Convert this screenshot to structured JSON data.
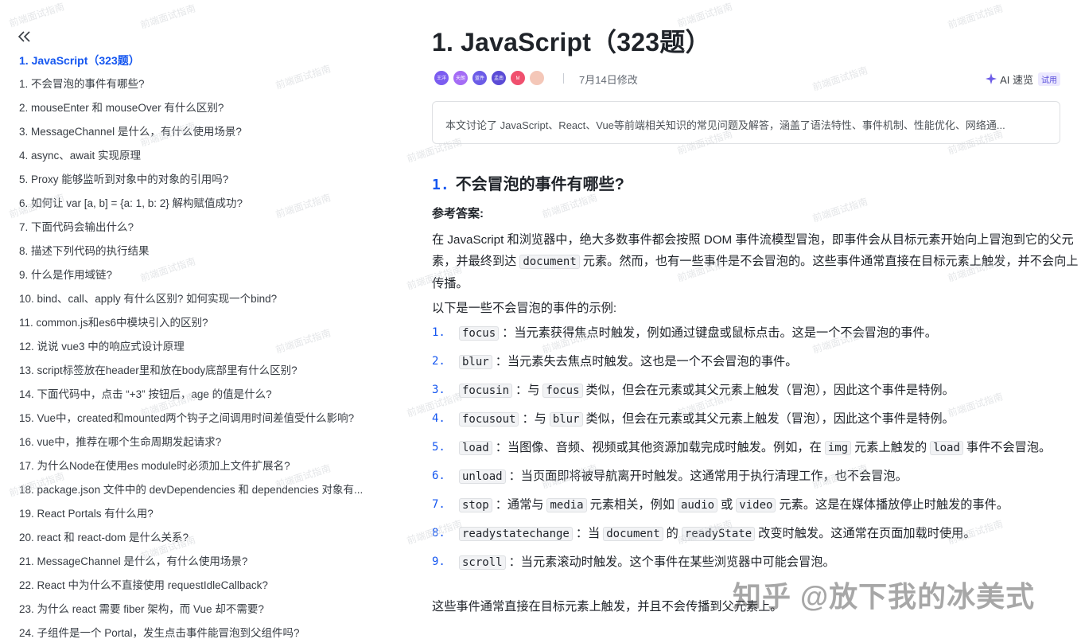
{
  "sidebar": {
    "toc": [
      "1. JavaScript（323题）",
      "1. 不会冒泡的事件有哪些?",
      "2. mouseEnter 和 mouseOver 有什么区别?",
      "3. MessageChannel 是什么，有什么使用场景?",
      "4. async、await 实现原理",
      "5. Proxy 能够监听到对象中的对象的引用吗?",
      "6. 如何让 var [a, b] = {a: 1, b: 2} 解构赋值成功?",
      "7. 下面代码会输出什么?",
      "8. 描述下列代码的执行结果",
      "9. 什么是作用域链?",
      "10. bind、call、apply 有什么区别? 如何实现一个bind?",
      "11. common.js和es6中模块引入的区别?",
      "12. 说说 vue3 中的响应式设计原理",
      "13. script标签放在header里和放在body底部里有什么区别?",
      "14. 下面代码中，点击 “+3” 按钮后，age 的值是什么?",
      "15. Vue中，created和mounted两个钩子之间调用时间差值受什么影响?",
      "16. vue中，推荐在哪个生命周期发起请求?",
      "17. 为什么Node在使用es module时必须加上文件扩展名?",
      "18. package.json 文件中的 devDependencies 和 dependencies 对象有...",
      "19. React Portals 有什么用?",
      "20. react 和 react-dom 是什么关系?",
      "21. MessageChannel 是什么，有什么使用场景?",
      "22. React 中为什么不直接使用 requestIdleCallback?",
      "23. 为什么 react 需要 fiber 架构，而 Vue 却不需要?",
      "24. 子组件是一个 Portal，发生点击事件能冒泡到父组件吗?"
    ]
  },
  "doc": {
    "title": "1. JavaScript（323题）",
    "avatars": [
      {
        "text": "王洋",
        "color": "#7b5cf0"
      },
      {
        "text": "天朗",
        "color": "#a46cf5"
      },
      {
        "text": "蓝件",
        "color": "#6c5ce7"
      },
      {
        "text": "孟南",
        "color": "#5b4bd6"
      },
      {
        "text": "M",
        "color": "#f0506e"
      },
      {
        "text": "",
        "color": "#f4c7b8"
      }
    ],
    "modified": "7月14日修改",
    "ai_label": "AI 速览",
    "ai_tag": "试用",
    "summary": "本文讨论了 JavaScript、React、Vue等前端相关知识的常见问题及解答，涵盖了语法特性、事件机制、性能优化、网络通...",
    "q_num": "1.",
    "q_title": "不会冒泡的事件有哪些?",
    "answer_label": "参考答案:",
    "para1_a": "在 JavaScript 和浏览器中，绝大多数事件都会按照 DOM 事件流模型冒泡，即事件会从目标元素开始向上冒泡到它的父元素，并最终到达",
    "para1_code": "document",
    "para1_b": "元素。然而，也有一些事件是不会冒泡的。这些事件通常直接在目标元素上触发，并不会向上传播。",
    "para2": "以下是一些不会冒泡的事件的示例:",
    "para3": "这些事件通常直接在目标元素上触发，并且不会传播到父元素上。",
    "events": [
      {
        "num": "1.",
        "parts": [
          {
            "c": "focus"
          },
          {
            "t": "：当元素获得焦点时触发，例如通过键盘或鼠标点击。这是一个不会冒泡的事件。"
          }
        ]
      },
      {
        "num": "2.",
        "parts": [
          {
            "c": "blur"
          },
          {
            "t": "：当元素失去焦点时触发。这也是一个不会冒泡的事件。"
          }
        ]
      },
      {
        "num": "3.",
        "parts": [
          {
            "c": "focusin"
          },
          {
            "t": "：与"
          },
          {
            "c": "focus"
          },
          {
            "t": "类似，但会在元素或其父元素上触发（冒泡），因此这个事件是特例。"
          }
        ]
      },
      {
        "num": "4.",
        "parts": [
          {
            "c": "focusout"
          },
          {
            "t": "：与"
          },
          {
            "c": "blur"
          },
          {
            "t": "类似，但会在元素或其父元素上触发（冒泡），因此这个事件是特例。"
          }
        ]
      },
      {
        "num": "5.",
        "parts": [
          {
            "c": "load"
          },
          {
            "t": "：当图像、音频、视频或其他资源加载完成时触发。例如，在"
          },
          {
            "c": "img"
          },
          {
            "t": "元素上触发的"
          },
          {
            "c": "load"
          },
          {
            "t": "事件不会冒泡。"
          }
        ]
      },
      {
        "num": "6.",
        "parts": [
          {
            "c": "unload"
          },
          {
            "t": "：当页面即将被导航离开时触发。这通常用于执行清理工作，也不会冒泡。"
          }
        ]
      },
      {
        "num": "7.",
        "parts": [
          {
            "c": "stop"
          },
          {
            "t": "：通常与"
          },
          {
            "c": "media"
          },
          {
            "t": "元素相关，例如"
          },
          {
            "c": "audio"
          },
          {
            "t": "或"
          },
          {
            "c": "video"
          },
          {
            "t": "元素。这是在媒体播放停止时触发的事件。"
          }
        ]
      },
      {
        "num": "8.",
        "parts": [
          {
            "c": "readystatechange"
          },
          {
            "t": "：当"
          },
          {
            "c": "document"
          },
          {
            "t": "的"
          },
          {
            "c": "readyState"
          },
          {
            "t": "改变时触发。这通常在页面加载时使用。"
          }
        ]
      },
      {
        "num": "9.",
        "parts": [
          {
            "c": "scroll"
          },
          {
            "t": "：当元素滚动时触发。这个事件在某些浏览器中可能会冒泡。"
          }
        ]
      }
    ]
  },
  "watermark": {
    "text": "前端面试指南",
    "brand": "知乎 @放下我的冰美式"
  },
  "colors": {
    "accent": "#1456f0",
    "text": "#1f2329",
    "muted": "#646a73",
    "code_bg": "#f2f3f5"
  }
}
